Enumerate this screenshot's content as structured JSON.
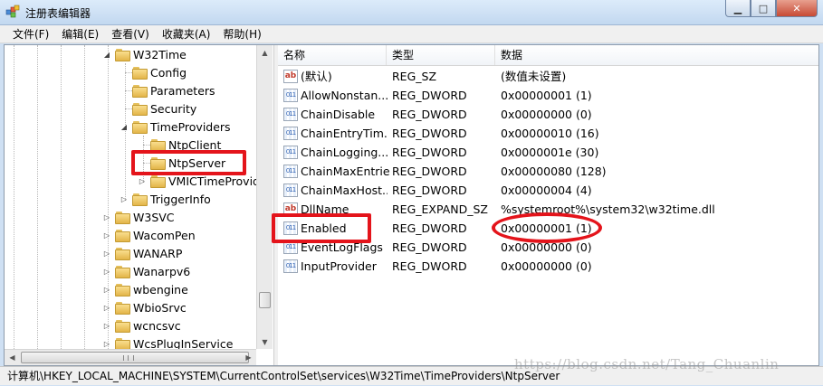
{
  "window": {
    "title": "注册表编辑器",
    "minimize_glyph": "▁",
    "maximize_glyph": "□",
    "close_glyph": "✕"
  },
  "menubar": {
    "items": [
      "文件(F)",
      "编辑(E)",
      "查看(V)",
      "收藏夹(A)",
      "帮助(H)"
    ]
  },
  "tree": {
    "nodes": [
      {
        "label": "W32Time",
        "expander": "◢"
      },
      {
        "label": "Config",
        "expander": ""
      },
      {
        "label": "Parameters",
        "expander": ""
      },
      {
        "label": "Security",
        "expander": ""
      },
      {
        "label": "TimeProviders",
        "expander": "◢"
      },
      {
        "label": "NtpClient",
        "expander": ""
      },
      {
        "label": "NtpServer",
        "expander": ""
      },
      {
        "label": "VMICTimeProvider",
        "expander": "▷"
      },
      {
        "label": "TriggerInfo",
        "expander": "▷"
      },
      {
        "label": "W3SVC",
        "expander": "▷"
      },
      {
        "label": "WacomPen",
        "expander": "▷"
      },
      {
        "label": "WANARP",
        "expander": "▷"
      },
      {
        "label": "Wanarpv6",
        "expander": "▷"
      },
      {
        "label": "wbengine",
        "expander": "▷"
      },
      {
        "label": "WbioSrvc",
        "expander": "▷"
      },
      {
        "label": "wcncsvc",
        "expander": "▷"
      },
      {
        "label": "WcsPlugInService",
        "expander": "▷"
      }
    ],
    "scroll_up": "▲",
    "scroll_down": "▼",
    "scroll_left": "◀",
    "scroll_right": "▶"
  },
  "list": {
    "headers": [
      "名称",
      "类型",
      "数据"
    ],
    "rows": [
      {
        "icon": "ab",
        "name": "(默认)",
        "type": "REG_SZ",
        "data": "(数值未设置)"
      },
      {
        "icon": "011",
        "name": "AllowNonstan...",
        "type": "REG_DWORD",
        "data": "0x00000001 (1)"
      },
      {
        "icon": "011",
        "name": "ChainDisable",
        "type": "REG_DWORD",
        "data": "0x00000000 (0)"
      },
      {
        "icon": "011",
        "name": "ChainEntryTim...",
        "type": "REG_DWORD",
        "data": "0x00000010 (16)"
      },
      {
        "icon": "011",
        "name": "ChainLogging...",
        "type": "REG_DWORD",
        "data": "0x0000001e (30)"
      },
      {
        "icon": "011",
        "name": "ChainMaxEntries",
        "type": "REG_DWORD",
        "data": "0x00000080 (128)"
      },
      {
        "icon": "011",
        "name": "ChainMaxHost...",
        "type": "REG_DWORD",
        "data": "0x00000004 (4)"
      },
      {
        "icon": "ab",
        "name": "DllName",
        "type": "REG_EXPAND_SZ",
        "data": "%systemroot%\\system32\\w32time.dll"
      },
      {
        "icon": "011",
        "name": "Enabled",
        "type": "REG_DWORD",
        "data": "0x00000001 (1)"
      },
      {
        "icon": "011",
        "name": "EventLogFlags",
        "type": "REG_DWORD",
        "data": "0x00000000 (0)"
      },
      {
        "icon": "011",
        "name": "InputProvider",
        "type": "REG_DWORD",
        "data": "0x00000000 (0)"
      }
    ]
  },
  "statusbar": {
    "path": "计算机\\HKEY_LOCAL_MACHINE\\SYSTEM\\CurrentControlSet\\services\\W32Time\\TimeProviders\\NtpServer"
  },
  "watermark": {
    "text": "https://blog.csdn.net/Tang_Chuanlin"
  },
  "colors": {
    "highlight": "#e4141b",
    "titlebar": "#c2d8f0"
  }
}
